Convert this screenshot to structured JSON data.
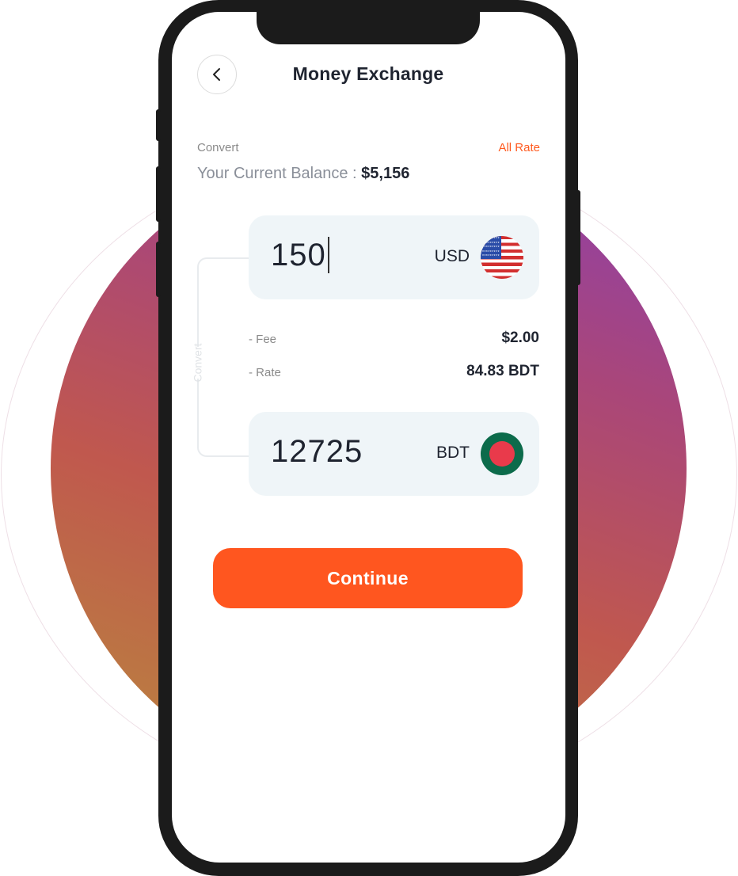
{
  "header": {
    "title": "Money Exchange",
    "back_icon": "chevron-left-icon"
  },
  "convert_section": {
    "label": "Convert",
    "all_rate_link": "All Rate",
    "balance_label": "Your Current Balance :",
    "balance_value": "$5,156"
  },
  "from": {
    "amount": "150",
    "currency": "USD",
    "flag_icon": "usa-flag-icon"
  },
  "to": {
    "amount": "12725",
    "currency": "BDT",
    "flag_icon": "bangladesh-flag-icon"
  },
  "connector_label": "Convert",
  "details": {
    "fee_label": "- Fee",
    "fee_value": "$2.00",
    "rate_label": "- Rate",
    "rate_value": "84.83 BDT"
  },
  "continue_label": "Continue",
  "colors": {
    "accent": "#ff561f",
    "card_bg": "#eff5f8",
    "text_dark": "#1f2430"
  }
}
